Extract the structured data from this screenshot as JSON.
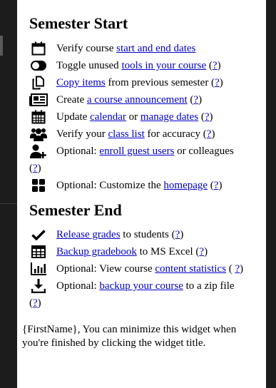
{
  "semester_start": {
    "heading": "Semester Start",
    "items": [
      {
        "pre": "Verify course ",
        "link": "start and end dates ",
        "mid": "",
        "link2": "",
        "post": "",
        "help": ""
      },
      {
        "pre": "Toggle unused ",
        "link": "tools in your course",
        "mid": "",
        "link2": "",
        "post": " (",
        "help": "?"
      },
      {
        "pre": "",
        "link": "Copy items",
        "mid": "",
        "link2": "",
        "post": " from previous semester (",
        "help": "?"
      },
      {
        "pre": "Create ",
        "link": "a course announcement",
        "mid": "",
        "link2": "",
        "post": " (",
        "help": "?"
      },
      {
        "pre": "Update ",
        "link": "calendar",
        "mid": " or ",
        "link2": "manage dates",
        "post": " (",
        "help": "?"
      },
      {
        "pre": "Verify your ",
        "link": "class list",
        "mid": "",
        "link2": "",
        "post": " for accuracy (",
        "help": "?"
      },
      {
        "pre": "Optional: ",
        "link": "enroll guest users",
        "mid": "",
        "link2": "",
        "post": " or colleagues",
        "help": "?"
      },
      {
        "pre": "Optional: Customize the ",
        "link": "homepage",
        "mid": "",
        "link2": "",
        "post": " (",
        "help": "?"
      }
    ]
  },
  "semester_end": {
    "heading": "Semester End",
    "items": [
      {
        "pre": "",
        "link": "Release grades",
        "post": " to students (",
        "help": "?"
      },
      {
        "pre": "",
        "link": "Backup gradebook",
        "post": " to MS Excel (",
        "help": "?"
      },
      {
        "pre": "Optional: View course ",
        "link": "content statistics",
        "post": " ( ",
        "help": "?"
      },
      {
        "pre": "Optional: ",
        "link": "backup your course",
        "post": " to a zip file",
        "help": "?"
      }
    ]
  },
  "close_paren": ")",
  "footer_note": "{FirstName}, You can minimize this widget when you're finished by clicking the widget title."
}
